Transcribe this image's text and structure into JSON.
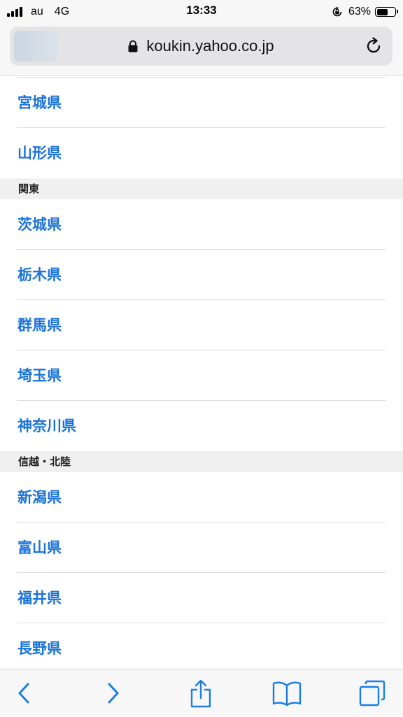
{
  "status_bar": {
    "carrier": "au",
    "network": "4G",
    "time": "13:33",
    "battery_percent": "63%",
    "battery_level": 0.63
  },
  "address_bar": {
    "url": "koukin.yahoo.co.jp"
  },
  "list": {
    "items_top": [
      "宮城県",
      "山形県"
    ],
    "sections": [
      {
        "header": "関東",
        "items": [
          "茨城県",
          "栃木県",
          "群馬県",
          "埼玉県",
          "神奈川県"
        ]
      },
      {
        "header": "信越・北陸",
        "items": [
          "新潟県",
          "富山県",
          "福井県",
          "長野県"
        ]
      }
    ]
  },
  "colors": {
    "link": "#1a73d9",
    "toolbar_icon": "#1a7ee6",
    "section_bg": "#f0f0f0"
  },
  "icons": {
    "back": "chevron-left-icon",
    "forward": "chevron-right-icon",
    "share": "share-icon",
    "bookmarks": "book-icon",
    "tabs": "tabs-icon",
    "lock": "lock-icon",
    "reload": "reload-icon"
  }
}
